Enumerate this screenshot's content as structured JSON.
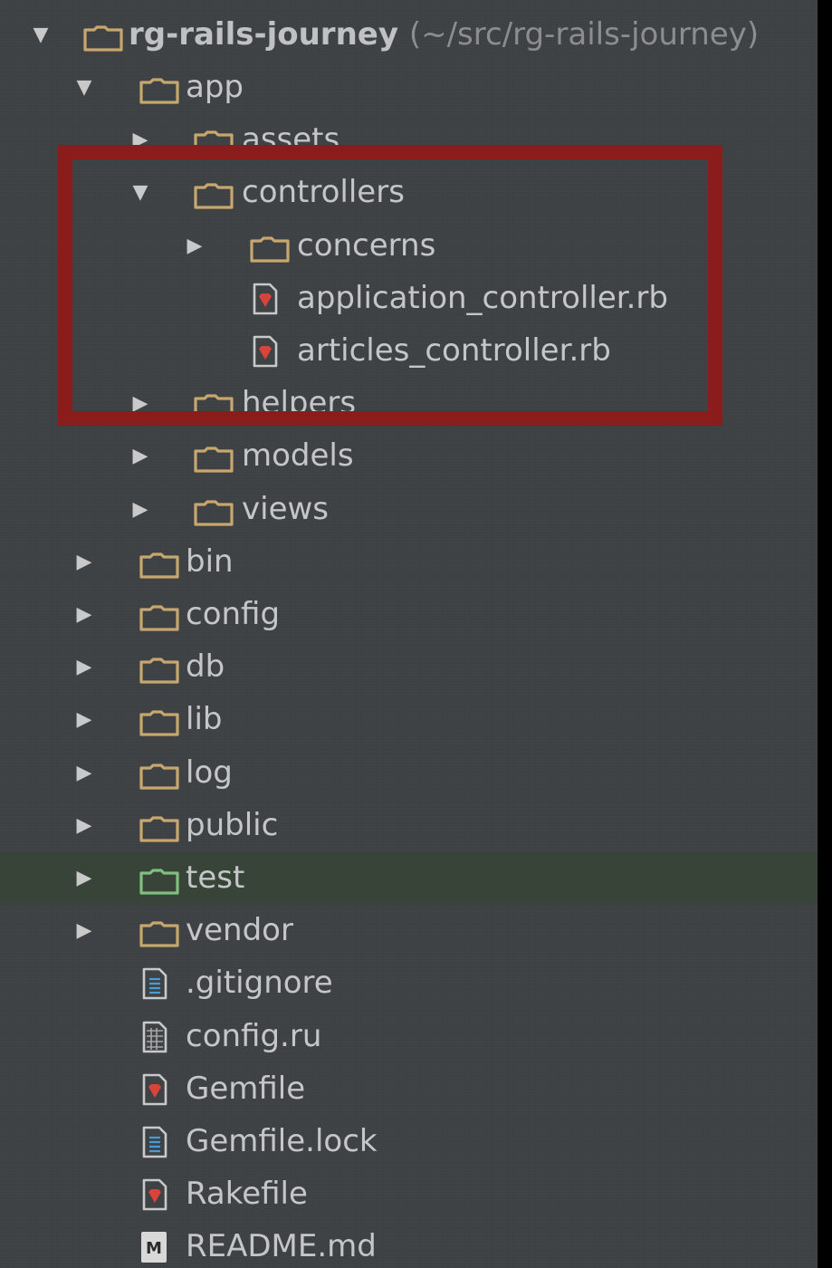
{
  "project": {
    "name": "rg-rails-journey",
    "path": "(~/src/rg-rails-journey)"
  },
  "tree": [
    {
      "label": "app",
      "level": 1,
      "type": "folder",
      "expanded": true
    },
    {
      "label": "assets",
      "level": 2,
      "type": "folder",
      "expanded": false
    },
    {
      "label": "controllers",
      "level": 2,
      "type": "folder",
      "expanded": true
    },
    {
      "label": "concerns",
      "level": 3,
      "type": "folder",
      "expanded": false
    },
    {
      "label": "application_controller.rb",
      "level": 3,
      "type": "ruby-file"
    },
    {
      "label": "articles_controller.rb",
      "level": 3,
      "type": "ruby-file"
    },
    {
      "label": "helpers",
      "level": 2,
      "type": "folder",
      "expanded": false
    },
    {
      "label": "models",
      "level": 2,
      "type": "folder",
      "expanded": false
    },
    {
      "label": "views",
      "level": 2,
      "type": "folder",
      "expanded": false
    },
    {
      "label": "bin",
      "level": 1,
      "type": "folder",
      "expanded": false
    },
    {
      "label": "config",
      "level": 1,
      "type": "folder",
      "expanded": false
    },
    {
      "label": "db",
      "level": 1,
      "type": "folder",
      "expanded": false
    },
    {
      "label": "lib",
      "level": 1,
      "type": "folder",
      "expanded": false
    },
    {
      "label": "log",
      "level": 1,
      "type": "folder",
      "expanded": false
    },
    {
      "label": "public",
      "level": 1,
      "type": "folder",
      "expanded": false
    },
    {
      "label": "test",
      "level": 1,
      "type": "test-folder",
      "expanded": false,
      "selected": true
    },
    {
      "label": "vendor",
      "level": 1,
      "type": "folder",
      "expanded": false
    },
    {
      "label": ".gitignore",
      "level": 1,
      "type": "text-file"
    },
    {
      "label": "config.ru",
      "level": 1,
      "type": "config-file"
    },
    {
      "label": "Gemfile",
      "level": 1,
      "type": "ruby-file"
    },
    {
      "label": "Gemfile.lock",
      "level": 1,
      "type": "text-file"
    },
    {
      "label": "Rakefile",
      "level": 1,
      "type": "ruby-file"
    },
    {
      "label": "README.md",
      "level": 1,
      "type": "markdown-file"
    }
  ],
  "colors": {
    "panel_bg": "#3d4143",
    "folder": "#c8a76f",
    "test_folder": "#7fbf7f",
    "ruby_red": "#d9443a",
    "file_body": "#c9c9c9",
    "text": "#c4c6c8",
    "selection": "#384437",
    "annotation": "#8b1c1c"
  },
  "icons": {
    "expanded": "triangle-down-icon",
    "collapsed": "triangle-right-icon",
    "folder": "folder-icon",
    "ruby": "ruby-file-icon",
    "text": "text-file-icon",
    "config": "config-file-icon",
    "markdown": "markdown-file-icon"
  },
  "markdown_badge": "M"
}
